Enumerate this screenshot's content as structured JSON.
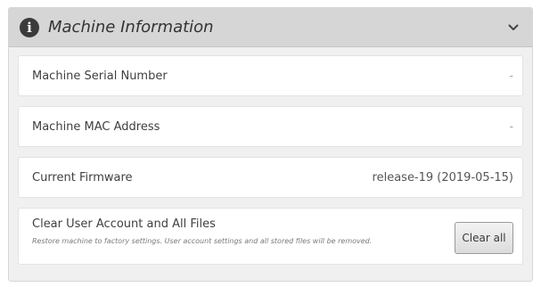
{
  "panel": {
    "title": "Machine Information",
    "info_icon_glyph": "i",
    "info_icon": "info-circle-icon",
    "collapse_icon": "chevron-down-icon"
  },
  "rows": [
    {
      "label": "Machine Serial Number",
      "value": "-"
    },
    {
      "label": "Machine MAC Address",
      "value": "-"
    },
    {
      "label": "Current Firmware",
      "value": "release-19 (2019-05-15)"
    }
  ],
  "clear": {
    "label": "Clear User Account and All Files",
    "description": "Restore machine to factory settings. User account settings and all stored files will be removed.",
    "button_label": "Clear all"
  },
  "colors": {
    "header_bg": "#d6d6d6",
    "panel_bg": "#f0f0f0",
    "row_bg": "#ffffff",
    "icon_bg": "#3b3b3b"
  }
}
